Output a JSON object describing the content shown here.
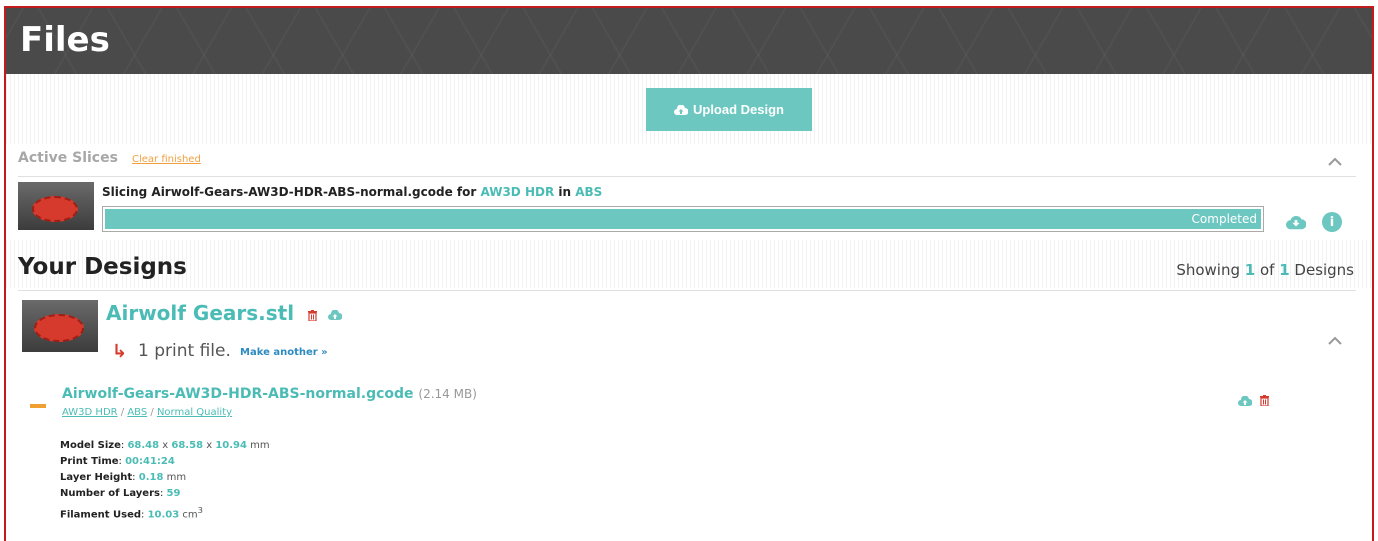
{
  "page_title": "Files",
  "upload_button": {
    "label": "Upload Design",
    "icon": "cloud-upload-icon"
  },
  "active_slices": {
    "title": "Active Slices",
    "clear_link": "Clear finished",
    "slice": {
      "prefix": "Slicing Airwolf-Gears-AW3D-HDR-ABS-normal.gcode for ",
      "printer": "AW3D HDR",
      "in": " in ",
      "material": "ABS",
      "status": "Completed",
      "progress": 100
    }
  },
  "your_designs": {
    "title": "Your Designs",
    "showing_prefix": "Showing ",
    "showing_current": "1",
    "showing_of": " of ",
    "showing_total": "1",
    "showing_suffix": " Designs"
  },
  "design": {
    "name": "Airwolf Gears.stl",
    "print_files": "1 print file.",
    "make_another": "Make another »"
  },
  "gcode": {
    "name": "Airwolf-Gears-AW3D-HDR-ABS-normal.gcode",
    "size": "(2.14 MB)",
    "printer": "AW3D HDR",
    "material": "ABS",
    "quality": "Normal Quality",
    "sep": " / "
  },
  "details": {
    "model_size_label": "Model Size",
    "model_x": "68.48",
    "model_y": "68.58",
    "model_z": "10.94",
    "x_sep": " x ",
    "mm": " mm",
    "print_time_label": "Print Time",
    "print_time": "00:41:24",
    "layer_height_label": "Layer Height",
    "layer_height": "0.18",
    "layers_label": "Number of Layers",
    "layers": "59",
    "filament_label": "Filament Used",
    "filament": "10.03",
    "cm": " cm",
    "cube": "3"
  },
  "colors": {
    "accent": "#6cc7c0",
    "teal_text": "#4bbcb5",
    "danger": "#d63a2c",
    "header": "#4a4a4a",
    "border": "#c21b1b"
  }
}
